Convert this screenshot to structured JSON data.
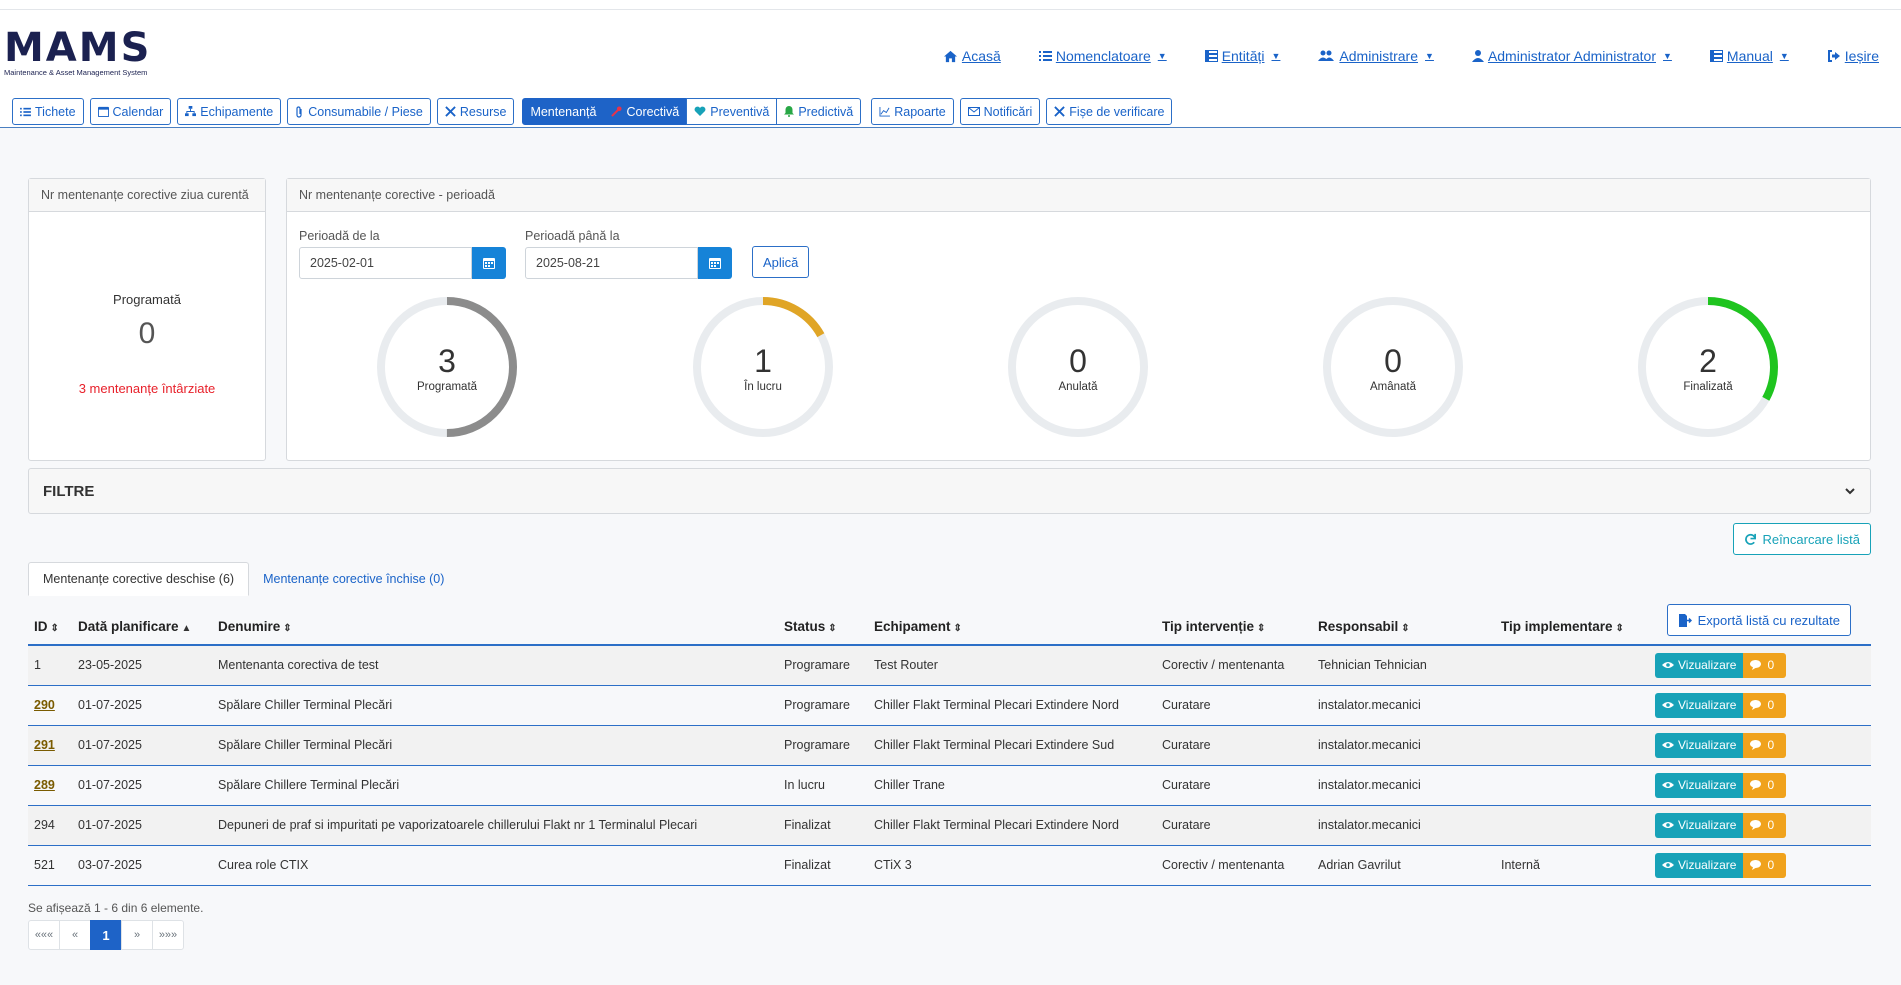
{
  "logo": {
    "text": "MAMS",
    "subtitle": "Maintenance & Asset Management System"
  },
  "topnav": [
    {
      "label": "Acasă",
      "icon": "home-icon",
      "caret": false
    },
    {
      "label": "Nomenclatoare",
      "icon": "list-icon",
      "caret": true
    },
    {
      "label": "Entități",
      "icon": "table-icon",
      "caret": true
    },
    {
      "label": "Administrare",
      "icon": "users-cog-icon",
      "caret": true
    },
    {
      "label": "Administrator Administrator",
      "icon": "user-icon",
      "caret": true
    },
    {
      "label": "Manual",
      "icon": "book-list-icon",
      "caret": true
    },
    {
      "label": "Ieșire",
      "icon": "sign-out-icon",
      "caret": false
    }
  ],
  "subnav": {
    "tichete": "Tichete",
    "calendar": "Calendar",
    "echipamente": "Echipamente",
    "consumabile": "Consumabile / Piese",
    "resurse": "Resurse",
    "mentenanta": "Mentenanță",
    "corectiva": "Corectivă",
    "preventiva": "Preventivă",
    "predictiva": "Predictivă",
    "rapoarte": "Rapoarte",
    "notificari": "Notificări",
    "fise": "Fișe de verificare"
  },
  "today_card": {
    "title": "Nr mentenanțe corective ziua curentă",
    "label": "Programată",
    "value": "0",
    "late": "3 mentenanțe întârziate"
  },
  "period_card": {
    "title": "Nr mentenanțe corective - perioadă",
    "from_label": "Perioadă de la",
    "from_value": "2025-02-01",
    "to_label": "Perioadă până la",
    "to_value": "2025-08-21",
    "apply": "Aplică"
  },
  "gauges": [
    {
      "value": "3",
      "label": "Programată",
      "fraction": 0.5,
      "color": "#8c8c8c"
    },
    {
      "value": "1",
      "label": "În lucru",
      "fraction": 0.17,
      "color": "#e0a526"
    },
    {
      "value": "0",
      "label": "Anulată",
      "fraction": 0,
      "color": "#cccccc"
    },
    {
      "value": "0",
      "label": "Amânată",
      "fraction": 0,
      "color": "#cccccc"
    },
    {
      "value": "2",
      "label": "Finalizată",
      "fraction": 0.33,
      "color": "#1fc41f"
    }
  ],
  "filters": {
    "title": "FILTRE"
  },
  "reload": "Reîncarcare listă",
  "tabs": {
    "open": "Mentenanțe corective deschise (6)",
    "closed": "Mentenanțe corective închise (0)"
  },
  "export": "Exportă listă cu rezultate",
  "table": {
    "columns": [
      "ID",
      "Dată planificare",
      "Denumire",
      "Status",
      "Echipament",
      "Tip intervenție",
      "Responsabil",
      "Tip implementare"
    ],
    "view_label": "Vizualizare",
    "rows": [
      {
        "id": "1",
        "link": false,
        "date": "23-05-2025",
        "name": "Mentenanta corectiva de test",
        "status": "Programare",
        "equipment": "Test Router",
        "type": "Corectiv / mentenanta",
        "resp": "Tehnician Tehnician",
        "impl": "",
        "comments": "0"
      },
      {
        "id": "290",
        "link": true,
        "date": "01-07-2025",
        "name": "Spălare Chiller Terminal Plecări",
        "status": "Programare",
        "equipment": "Chiller Flakt Terminal Plecari Extindere Nord",
        "type": "Curatare",
        "resp": "instalator.mecanici",
        "impl": "",
        "comments": "0"
      },
      {
        "id": "291",
        "link": true,
        "date": "01-07-2025",
        "name": "Spălare Chiller Terminal Plecări",
        "status": "Programare",
        "equipment": "Chiller Flakt Terminal Plecari Extindere Sud",
        "type": "Curatare",
        "resp": "instalator.mecanici",
        "impl": "",
        "comments": "0"
      },
      {
        "id": "289",
        "link": true,
        "date": "01-07-2025",
        "name": "Spălare Chillere Terminal Plecări",
        "status": "In lucru",
        "equipment": "Chiller Trane",
        "type": "Curatare",
        "resp": "instalator.mecanici",
        "impl": "",
        "comments": "0"
      },
      {
        "id": "294",
        "link": false,
        "date": "01-07-2025",
        "name": "Depuneri de praf si impuritati pe vaporizatoarele chillerului Flakt nr 1 Terminalul Plecari",
        "status": "Finalizat",
        "equipment": "Chiller Flakt Terminal Plecari Extindere Nord",
        "type": "Curatare",
        "resp": "instalator.mecanici",
        "impl": "",
        "comments": "0"
      },
      {
        "id": "521",
        "link": false,
        "date": "03-07-2025",
        "name": "Curea role CTIX",
        "status": "Finalizat",
        "equipment": "CTiX 3",
        "type": "Corectiv / mentenanta",
        "resp": "Adrian Gavrilut",
        "impl": "Internă",
        "comments": "0"
      }
    ]
  },
  "pagination": {
    "summary": "Se afișează 1 - 6 din 6 elemente.",
    "first": "«««",
    "prev": "«",
    "current": "1",
    "next": "»",
    "last": "»»»"
  }
}
